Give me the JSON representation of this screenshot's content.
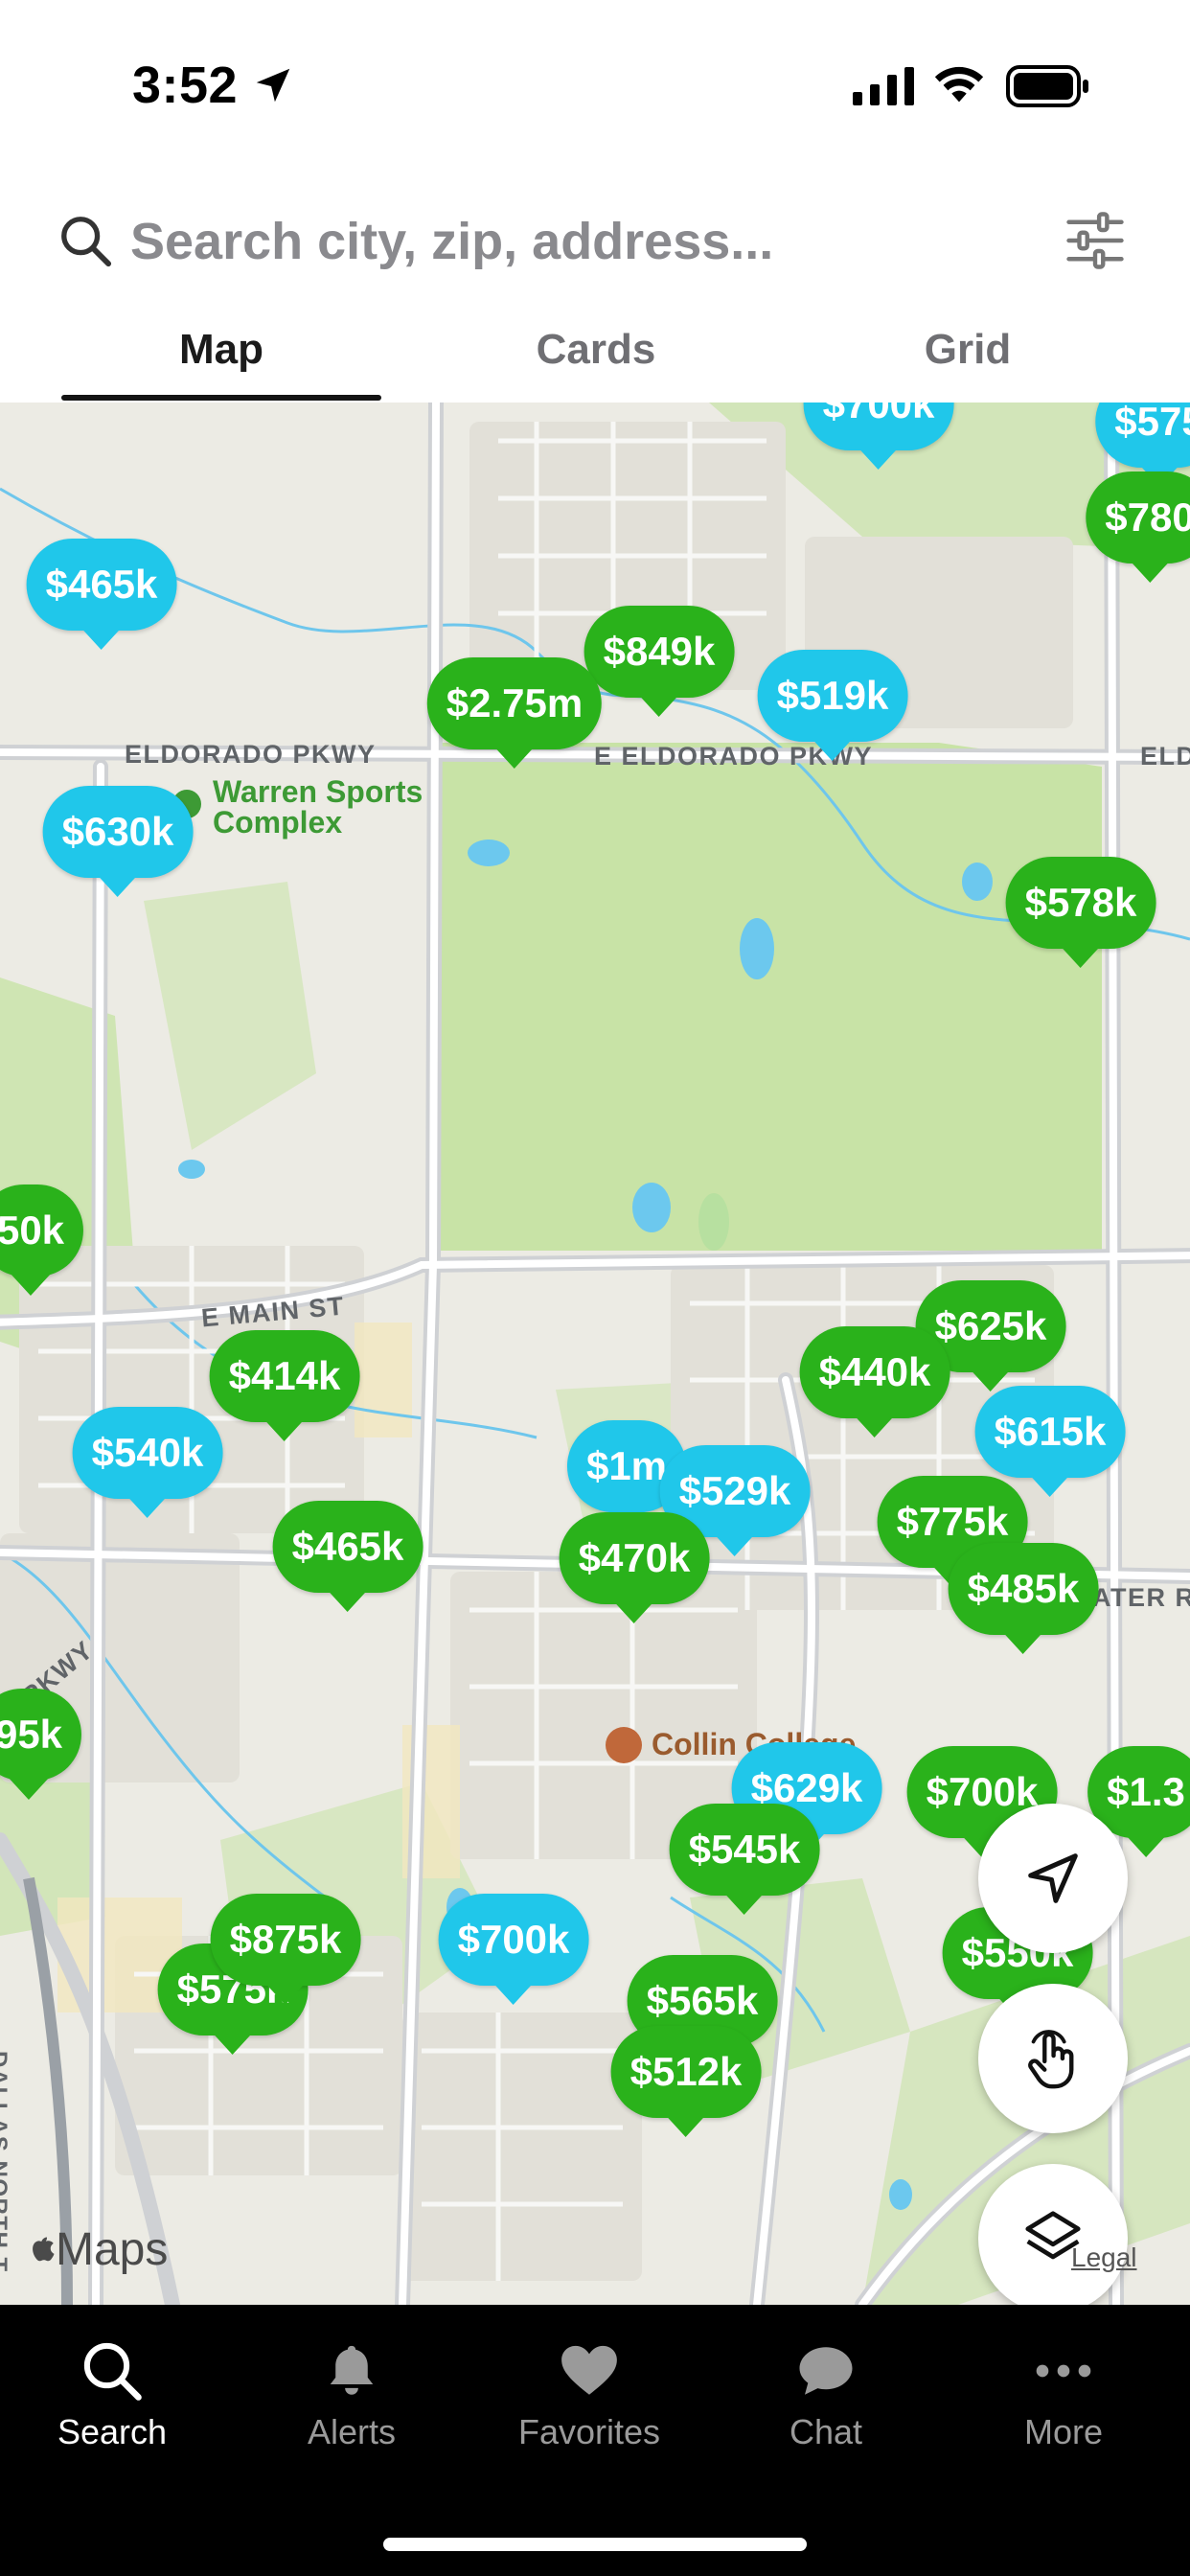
{
  "status_bar": {
    "time": "3:52"
  },
  "search": {
    "placeholder": "Search city, zip, address..."
  },
  "tabs": [
    {
      "label": "Map",
      "active": true
    },
    {
      "label": "Cards",
      "active": false
    },
    {
      "label": "Grid",
      "active": false
    }
  ],
  "map": {
    "road_labels": [
      "ELDORADO PKWY",
      "E ELDORADO PKWY",
      "ELD",
      "E MAIN ST",
      "SOLATER RD",
      "Y PKWY",
      "DALLAS NORTH T"
    ],
    "places": {
      "sports": "Warren Sports Complex",
      "sports_line1": "Warren Sports",
      "sports_line2": "Complex",
      "college": "Collin College"
    },
    "brand": "Maps",
    "legal": "Legal",
    "colors": {
      "for_sale": "#2ab21b",
      "rental": "#20c7ea"
    },
    "pins": [
      {
        "price": "$700k",
        "type": "rental"
      },
      {
        "price": "$575",
        "type": "rental"
      },
      {
        "price": "$780",
        "type": "sale"
      },
      {
        "price": "$465k",
        "type": "rental"
      },
      {
        "price": "$849k",
        "type": "sale"
      },
      {
        "price": "$2.75m",
        "type": "sale"
      },
      {
        "price": "$519k",
        "type": "rental"
      },
      {
        "price": "$630k",
        "type": "rental"
      },
      {
        "price": "$578k",
        "type": "sale"
      },
      {
        "price": "50k",
        "type": "sale"
      },
      {
        "price": "$625k",
        "type": "sale"
      },
      {
        "price": "$414k",
        "type": "sale"
      },
      {
        "price": "$440k",
        "type": "sale"
      },
      {
        "price": "$615k",
        "type": "rental"
      },
      {
        "price": "$540k",
        "type": "rental"
      },
      {
        "price": "$1m",
        "type": "rental"
      },
      {
        "price": "$529k",
        "type": "rental"
      },
      {
        "price": "$775k",
        "type": "sale"
      },
      {
        "price": "$465k",
        "type": "sale"
      },
      {
        "price": "$470k",
        "type": "sale"
      },
      {
        "price": "$485k",
        "type": "sale"
      },
      {
        "price": "95k",
        "type": "sale"
      },
      {
        "price": "$629k",
        "type": "rental"
      },
      {
        "price": "$545k",
        "type": "sale"
      },
      {
        "price": "$700k",
        "type": "rental"
      },
      {
        "price": "$550k",
        "type": "sale"
      },
      {
        "price": "$575k",
        "type": "sale"
      },
      {
        "price": "$565k",
        "type": "sale"
      },
      {
        "price": "$512k",
        "type": "sale"
      },
      {
        "price": "$875k",
        "type": "sale"
      },
      {
        "price": "$1.3",
        "type": "sale"
      },
      {
        "price": "$700k",
        "type": "sale"
      }
    ]
  },
  "map_controls": [
    {
      "icon": "location-arrow-icon"
    },
    {
      "icon": "draw-hand-icon"
    },
    {
      "icon": "layers-icon"
    }
  ],
  "bottom_nav": [
    {
      "label": "Search",
      "icon": "search-icon",
      "active": true
    },
    {
      "label": "Alerts",
      "icon": "bell-icon",
      "active": false
    },
    {
      "label": "Favorites",
      "icon": "heart-icon",
      "active": false
    },
    {
      "label": "Chat",
      "icon": "chat-bubble-icon",
      "active": false
    },
    {
      "label": "More",
      "icon": "more-dots-icon",
      "active": false
    }
  ]
}
